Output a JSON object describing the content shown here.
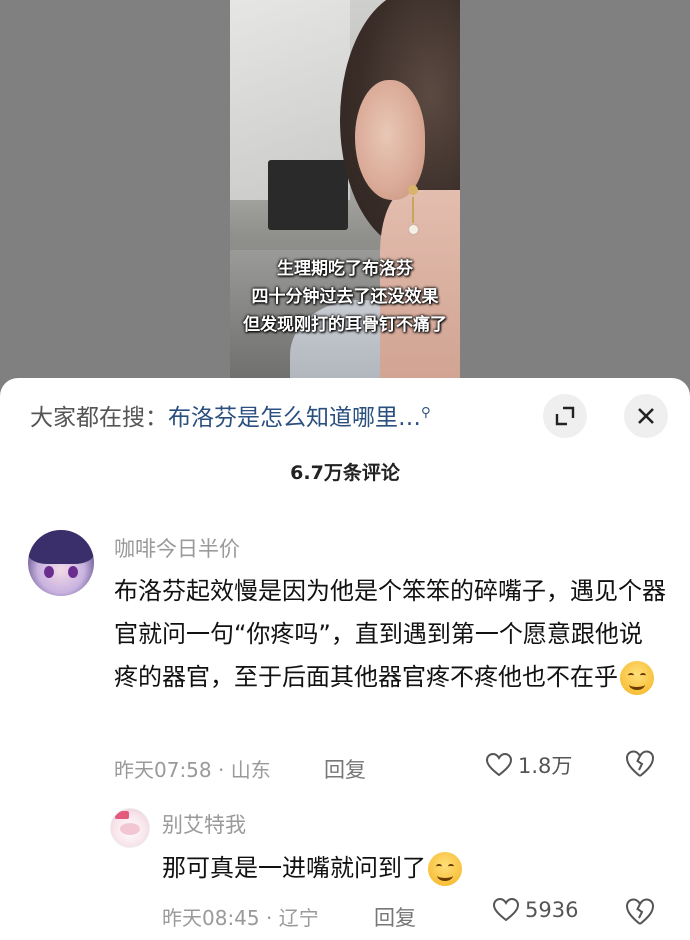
{
  "video": {
    "caption_lines": [
      "生理期吃了布洛芬",
      "四十分钟过去了还没效果",
      "但发现刚打的耳骨钉不痛了"
    ]
  },
  "search": {
    "prefix": "大家都在搜：",
    "query": "布洛芬是怎么知道哪里…",
    "icon": "search-icon"
  },
  "header": {
    "comment_count": "6.7万条评论",
    "expand_icon": "expand-icon",
    "close_icon": "close-icon"
  },
  "comments": [
    {
      "username": "咖啡今日半价",
      "text": "布洛芬起效慢是因为他是个笨笨的碎嘴子，遇见个器官就问一句“你疼吗”，直到遇到第一个愿意跟他说疼的器官，至于后面其他器官疼不疼他也不在乎",
      "emoji": "grin-emoji",
      "time_location": "昨天07:58 · 山东",
      "reply_label": "回复",
      "likes": "1.8万"
    },
    {
      "username": "别艾特我",
      "text": "那可真是一进嘴就问到了",
      "emoji": "smile-emoji",
      "time_location": "昨天08:45 · 辽宁",
      "reply_label": "回复",
      "likes": "5936"
    }
  ],
  "colors": {
    "link": "#2b4f7f",
    "muted": "#9a9a9a",
    "sheet_bg": "#ffffff",
    "backdrop": "#808080"
  }
}
